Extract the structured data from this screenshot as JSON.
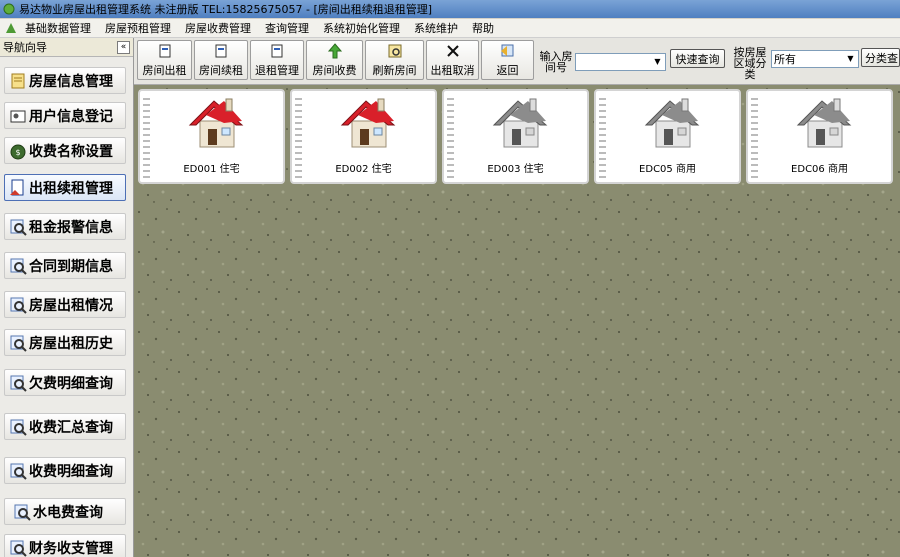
{
  "window": {
    "title": "易达物业房屋出租管理系统 未注册版 TEL:15825675057 - [房间出租续租退租管理]"
  },
  "menu": [
    "基础数据管理",
    "房屋预租管理",
    "房屋收费管理",
    "查询管理",
    "系统初始化管理",
    "系统维护",
    "帮助"
  ],
  "nav": {
    "header": "导航向导",
    "collapse": "«",
    "items": [
      {
        "label": "房屋信息管理",
        "icon": "document-icon"
      },
      {
        "label": "用户信息登记",
        "icon": "user-card-icon"
      },
      {
        "label": "收费名称设置",
        "icon": "money-bag-icon"
      },
      {
        "label": "出租续租管理",
        "icon": "contract-icon"
      },
      {
        "label": "租金报警信息",
        "icon": "magnifier-icon"
      },
      {
        "label": "合同到期信息",
        "icon": "magnifier-icon"
      },
      {
        "label": "房屋出租情况",
        "icon": "magnifier-icon"
      },
      {
        "label": "房屋出租历史",
        "icon": "magnifier-icon"
      },
      {
        "label": "欠费明细查询",
        "icon": "magnifier-icon"
      },
      {
        "label": "收费汇总查询",
        "icon": "magnifier-icon"
      },
      {
        "label": "收费明细查询",
        "icon": "magnifier-icon"
      },
      {
        "label": "水电费查询",
        "icon": "magnifier-icon"
      },
      {
        "label": "财务收支管理",
        "icon": "magnifier-icon"
      }
    ]
  },
  "toolbar": {
    "buttons": [
      {
        "label": "房间出租",
        "icon": "rent-icon"
      },
      {
        "label": "房间续租",
        "icon": "renew-icon"
      },
      {
        "label": "退租管理",
        "icon": "return-icon"
      },
      {
        "label": "房间收费",
        "icon": "charge-icon"
      },
      {
        "label": "刷新房间",
        "icon": "refresh-icon"
      },
      {
        "label": "出租取消",
        "icon": "close-icon"
      },
      {
        "label": "返回",
        "icon": "back-icon"
      }
    ],
    "room_label_1": "输入房",
    "room_label_2": "间号",
    "room_value": "",
    "quick_search": "快速查询",
    "area_label_1": "按房屋",
    "area_label_2": "区域分类",
    "area_value": "所有",
    "classify_search": "分类查"
  },
  "rooms": [
    {
      "label": "ED001 住宅",
      "status": "rented",
      "roof_color": "#d9202a"
    },
    {
      "label": "ED002 住宅",
      "status": "rented",
      "roof_color": "#d9202a"
    },
    {
      "label": "ED003 住宅",
      "status": "vacant",
      "roof_color": "#8c8c8c"
    },
    {
      "label": "EDC05 商用",
      "status": "vacant",
      "roof_color": "#8c8c8c"
    },
    {
      "label": "EDC06 商用",
      "status": "vacant",
      "roof_color": "#8c8c8c"
    }
  ],
  "colors": {
    "content_bg": "#8a8c70",
    "rented_roof": "#d9202a",
    "vacant_roof": "#8c8c8c"
  }
}
